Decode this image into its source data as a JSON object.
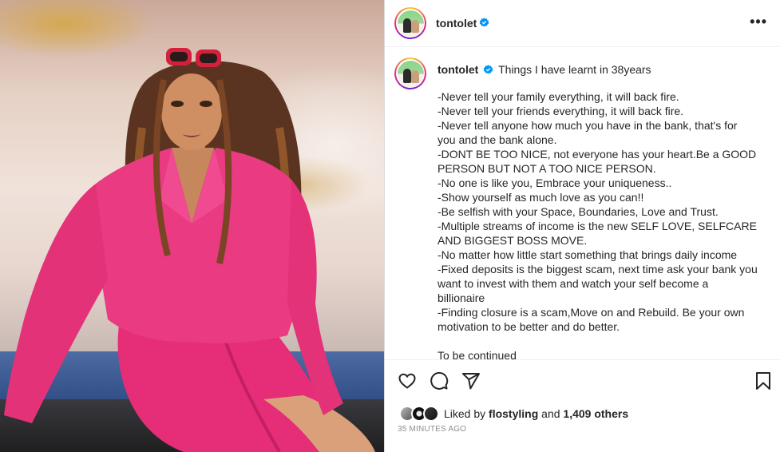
{
  "post": {
    "username": "tontolet",
    "verified_icon": "verified-badge-icon",
    "more_icon": "more-options-icon",
    "more_label": "•••"
  },
  "caption": {
    "username": "tontolet",
    "title": "Things I have learnt in 38years",
    "lines": [
      "-Never tell your family everything, it will back fire.",
      "-Never tell your friends everything, it will back fire.",
      "-Never tell anyone how much you have in the bank, that's for",
      "you and the bank alone.",
      "-DONT BE TOO NICE, not everyone has your heart.Be a GOOD",
      "PERSON BUT NOT A TOO NICE PERSON.",
      "-No one is like you, Embrace your uniqueness..",
      "-Show yourself as much love as you can!!",
      "-Be selfish with your Space, Boundaries, Love and Trust.",
      "-Multiple streams of income is the new SELF LOVE, SELFCARE",
      "AND BIGGEST BOSS MOVE.",
      "-No matter how little start something that brings daily income",
      "-Fixed deposits is the biggest scam, next time ask your bank you",
      "want to invest with them and watch your self become a",
      "billionaire",
      "-Finding closure is a scam,Move on and Rebuild. Be your own",
      "motivation to be better and do better.",
      "",
      "To be continued"
    ]
  },
  "actions": {
    "like_icon": "heart-icon",
    "comment_icon": "comment-icon",
    "share_icon": "share-icon",
    "save_icon": "bookmark-icon"
  },
  "likes": {
    "prefix": "Liked by",
    "user": "flostyling",
    "joiner": "and",
    "others": "1,409 others"
  },
  "timestamp": "35 MINUTES AGO",
  "colors": {
    "verified": "#0095f6",
    "blazer": "#e8357a",
    "text": "#262626",
    "muted": "#8e8e8e"
  }
}
